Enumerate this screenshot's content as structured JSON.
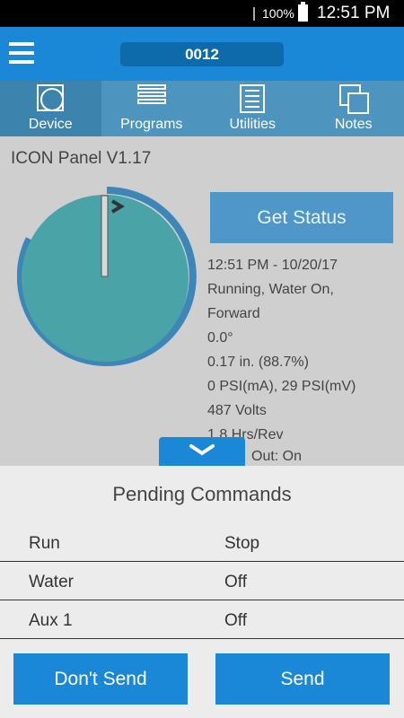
{
  "status_bar": {
    "battery": "100%",
    "time": "12:51 PM"
  },
  "app_bar": {
    "device_id": "0012"
  },
  "tabs": [
    {
      "label": "Device",
      "icon": "device-icon"
    },
    {
      "label": "Programs",
      "icon": "programs-icon"
    },
    {
      "label": "Utilities",
      "icon": "utilities-icon"
    },
    {
      "label": "Notes",
      "icon": "notes-icon"
    }
  ],
  "panel": {
    "title": "ICON Panel V1.17",
    "get_status_label": "Get Status",
    "status_lines": [
      "12:51 PM - 10/20/17",
      "Running, Water On,",
      "Forward",
      "0.0°",
      "0.17 in. (88.7%)",
      "0 PSI(mA), 29 PSI(mV)",
      "487 Volts",
      "1.8 Hrs/Rev"
    ],
    "status_tail": "Out: On",
    "position_deg": 0.0
  },
  "pending": {
    "title": "Pending Commands",
    "rows": [
      {
        "name": "Run",
        "value": "Stop"
      },
      {
        "name": "Water",
        "value": "Off"
      },
      {
        "name": "Aux 1",
        "value": "Off"
      }
    ],
    "dont_send_label": "Don't Send",
    "send_label": "Send"
  },
  "colors": {
    "accent": "#1a88d6",
    "tab_bar": "#4d94bf",
    "dial_face": "#4aa3a6",
    "dial_ring": "#3d86b8"
  }
}
